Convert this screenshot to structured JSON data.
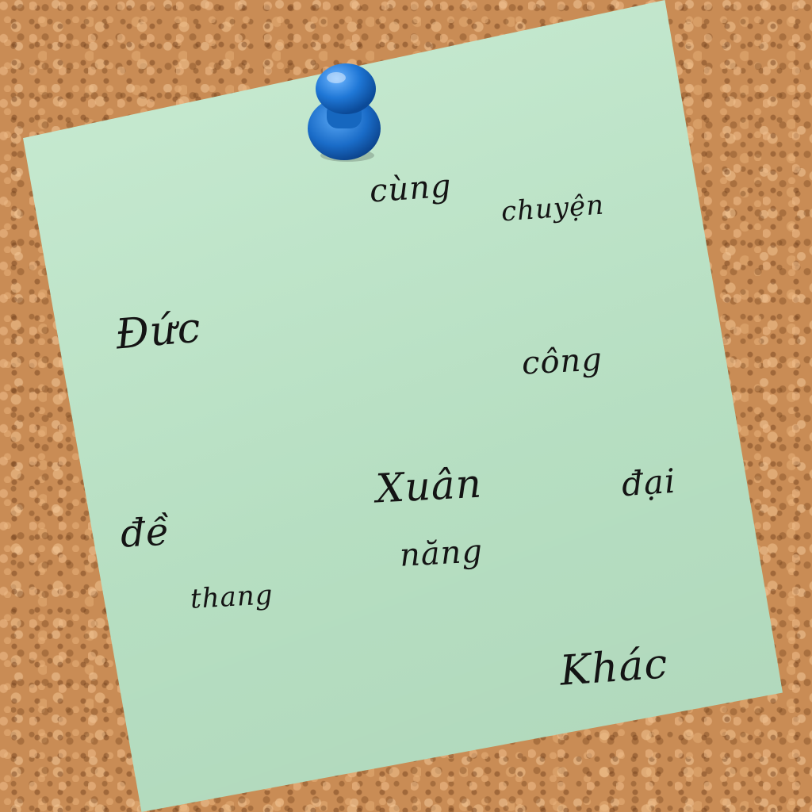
{
  "scene": {
    "description_colors": {
      "board": "#c98c55",
      "note": "#bde7c9",
      "pin": "#1f77d6",
      "ink": "#141414"
    },
    "pin_icon": "pushpin-icon"
  },
  "note": {
    "words": [
      "cùng",
      "chuyện",
      "Đức",
      "công",
      "Xuân",
      "đại",
      "đề",
      "năng",
      "thang",
      "Khác"
    ]
  }
}
